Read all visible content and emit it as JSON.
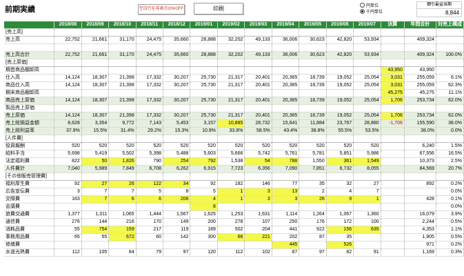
{
  "header": {
    "title": "前期実績",
    "toggle_label": "空白行を非表示ON/OFF",
    "print_label": "印刷",
    "unit_yen": "円単位",
    "unit_thousand": "千円単位",
    "days_label": "棚引最益当期",
    "days_value": "8,844"
  },
  "table": {
    "columns": [
      "2018/08",
      "2018/09",
      "2018/10",
      "2018/11",
      "2018/12",
      "2019/01",
      "2019/02",
      "2019/03",
      "2019/04",
      "2019/05",
      "2019/06",
      "2019/07",
      "決算",
      "年間合計",
      "対売上構成"
    ],
    "rows": [
      {
        "label": "[売上高]",
        "type": "section",
        "cells": [
          "",
          "",
          "",
          "",
          "",
          "",
          "",
          "",
          "",
          "",
          "",
          "",
          "",
          "",
          ""
        ]
      },
      {
        "label": "売上高",
        "cells": [
          "22,752",
          "21,661",
          "31,170",
          "24,475",
          "35,660",
          "28,888",
          "32,202",
          "49,133",
          "36,006",
          "30,623",
          "42,820",
          "53,934",
          "",
          "409,324",
          ""
        ]
      },
      {
        "label": "",
        "cells": [
          "",
          "",
          "",
          "",
          "",
          "",
          "",
          "",
          "",
          "",
          "",
          "",
          "",
          "",
          ""
        ]
      },
      {
        "label": "売上高合計",
        "type": "total",
        "cells": [
          "22,752",
          "21,661",
          "31,170",
          "24,475",
          "35,660",
          "28,888",
          "32,202",
          "49,133",
          "36,006",
          "30,623",
          "42,820",
          "53,934",
          "",
          "409,324",
          "100.0%"
        ]
      },
      {
        "label": "[売上原価]",
        "type": "section",
        "cells": [
          "",
          "",
          "",
          "",
          "",
          "",
          "",
          "",
          "",
          "",
          "",
          "",
          "",
          "",
          ""
        ]
      },
      {
        "label": "期首商品棚卸高",
        "cells": [
          "",
          "",
          "",
          "",
          "",
          "",
          "",
          "",
          "",
          "",
          "",
          "",
          "43,950",
          "43,950",
          ""
        ],
        "hl": [
          12
        ]
      },
      {
        "label": "仕入高",
        "cells": [
          "14,124",
          "18,307",
          "21,398",
          "17,332",
          "30,207",
          "25,730",
          "21,317",
          "20,401",
          "20,365",
          "18,739",
          "19,052",
          "25,054",
          "3,031",
          "255,059",
          "6.1%"
        ],
        "hl": [
          12
        ]
      },
      {
        "label": "商品仕入高",
        "cells": [
          "14,124",
          "18,307",
          "21,398",
          "17,332",
          "30,207",
          "25,730",
          "21,317",
          "20,401",
          "20,365",
          "18,739",
          "19,052",
          "25,054",
          "3,031",
          "255,059",
          "62.3%"
        ],
        "hl": [
          12
        ]
      },
      {
        "label": "期末商品棚卸高",
        "cells": [
          "",
          "",
          "",
          "",
          "",
          "",
          "",
          "",
          "",
          "",
          "",
          "",
          "45,275",
          "45,275",
          "11.1%"
        ],
        "hl": [
          12
        ]
      },
      {
        "label": "商品売上原価",
        "type": "total",
        "cells": [
          "14,124",
          "18,307",
          "21,398",
          "17,332",
          "30,207",
          "25,730",
          "21,317",
          "20,401",
          "20,365",
          "18,739",
          "19,052",
          "25,054",
          "1,706",
          "253,734",
          "62.0%"
        ],
        "hl": [
          12
        ]
      },
      {
        "label": "製品売上原価",
        "cells": [
          "",
          "",
          "",
          "",
          "",
          "",
          "",
          "",
          "",
          "",
          "",
          "",
          "",
          "",
          ""
        ]
      },
      {
        "label": "売上原価",
        "type": "total",
        "cells": [
          "14,124",
          "18,307",
          "21,398",
          "17,332",
          "30,207",
          "25,730",
          "21,317",
          "20,401",
          "20,365",
          "18,739",
          "19,052",
          "25,054",
          "1,706",
          "253,734",
          "62.0%"
        ],
        "hl": [
          12
        ]
      },
      {
        "label": "売上総損益金額",
        "type": "total",
        "cells": [
          "8,628",
          "3,354",
          "9,772",
          "7,143",
          "5,453",
          "3,157",
          "10,885",
          "28,732",
          "15,641",
          "11,884",
          "23,767",
          "28,880",
          "-1,706",
          "155,590",
          "38.0%"
        ],
        "hl": [
          6
        ],
        "neg": [
          12
        ]
      },
      {
        "label": "売上総利益率",
        "type": "total",
        "cells": [
          "37.9%",
          "15.5%",
          "31.4%",
          "29.2%",
          "15.3%",
          "10.9%",
          "33.8%",
          "58.5%",
          "43.4%",
          "38.8%",
          "55.5%",
          "53.5%",
          "",
          "38.0%",
          "0.0%"
        ]
      },
      {
        "label": "[人件費]",
        "type": "section",
        "cells": [
          "",
          "",
          "",
          "",
          "",
          "",
          "",
          "",
          "",
          "",
          "",
          "",
          "",
          "",
          ""
        ]
      },
      {
        "label": "役員報酬",
        "cells": [
          "520",
          "520",
          "520",
          "520",
          "520",
          "520",
          "520",
          "520",
          "520",
          "520",
          "520",
          "520",
          "",
          "6,240",
          "1.5%"
        ]
      },
      {
        "label": "給料手当",
        "cells": [
          "5,698",
          "5,419",
          "5,502",
          "5,398",
          "5,488",
          "5,603",
          "5,666",
          "5,742",
          "5,761",
          "5,781",
          "5,851",
          "5,986",
          "",
          "67,556",
          "16.5%"
        ]
      },
      {
        "label": "法定福利費",
        "cells": [
          "822",
          "50",
          "1,826",
          "790",
          "254",
          "792",
          "1,538",
          "54",
          "788",
          "1,550",
          "361",
          "1,549",
          "",
          "10,373",
          "2.5%"
        ],
        "hl": [
          1,
          2,
          4,
          5,
          7,
          8,
          10,
          11
        ]
      },
      {
        "label": "人件費計",
        "type": "total",
        "cells": [
          "7,040",
          "5,989",
          "7,849",
          "6,708",
          "6,262",
          "6,915",
          "7,723",
          "6,356",
          "7,090",
          "7,851",
          "6,732",
          "8,055",
          "",
          "84,569",
          "20.7%"
        ]
      },
      {
        "label": "[その他販売管理費]",
        "type": "section",
        "cells": [
          "",
          "",
          "",
          "",
          "",
          "",
          "",
          "",
          "",
          "",
          "",
          "",
          "",
          "",
          ""
        ]
      },
      {
        "label": "福利厚生費",
        "cells": [
          "92",
          "27",
          "26",
          "122",
          "34",
          "92",
          "182",
          "146",
          "77",
          "35",
          "32",
          "27",
          "",
          "892",
          "0.2%"
        ],
        "hl": [
          1,
          2,
          3,
          4
        ]
      },
      {
        "label": "広告宣伝費",
        "cells": [
          "3",
          "7",
          "7",
          "5",
          "8",
          "5",
          "1",
          "3",
          "13",
          "2",
          "4",
          "7",
          "",
          "",
          "0.0%"
        ],
        "hl": [
          6,
          7,
          8
        ]
      },
      {
        "label": "交際費",
        "cells": [
          "163",
          "7",
          "6",
          "6",
          "206",
          "4",
          "1",
          "3",
          "3",
          "26",
          "9",
          "1",
          "",
          "428",
          "0.1%"
        ],
        "hl": [
          1,
          2,
          3,
          4,
          5,
          6,
          7,
          8,
          9,
          10,
          11
        ]
      },
      {
        "label": "会議費",
        "cells": [
          "",
          "",
          "",
          "",
          "",
          "8",
          "",
          "",
          "",
          "",
          "",
          "",
          "",
          "",
          "0.0%"
        ],
        "hl": [
          5
        ]
      },
      {
        "label": "旅費交通費",
        "cells": [
          "1,377",
          "1,311",
          "1,065",
          "1,444",
          "1,567",
          "1,625",
          "1,253",
          "1,631",
          "1,114",
          "1,264",
          "1,067",
          "1,360",
          "",
          "16,079",
          "3.9%"
        ]
      },
      {
        "label": "通信費",
        "cells": [
          "276",
          "144",
          "216",
          "170",
          "149",
          "200",
          "278",
          "107",
          "250",
          "176",
          "172",
          "100",
          "",
          "2,244",
          "0.5%"
        ]
      },
      {
        "label": "消耗品費",
        "cells": [
          "55",
          "754",
          "159",
          "217",
          "119",
          "189",
          "502",
          "204",
          "441",
          "922",
          "156",
          "635",
          "",
          "4,353",
          "1.1%"
        ],
        "hl": [
          1,
          2,
          10,
          11
        ]
      },
      {
        "label": "事務用品費",
        "cells": [
          "65",
          "55",
          "672",
          "60",
          "142",
          "300",
          "66",
          "221",
          "202",
          "87",
          "35",
          "",
          "",
          "1,905",
          "0.5%"
        ],
        "hl": [
          2,
          6,
          7
        ]
      },
      {
        "label": "修繕費",
        "cells": [
          "",
          "",
          "",
          "",
          "",
          "",
          "",
          "",
          "445",
          "",
          "526",
          "",
          "",
          "971",
          "0.2%"
        ],
        "hl": [
          8,
          10
        ]
      },
      {
        "label": "水道光熱費",
        "cells": [
          "112",
          "105",
          "84",
          "79",
          "97",
          "120",
          "112",
          "102",
          "87",
          "97",
          "82",
          "91",
          "",
          "1,169",
          "0.3%"
        ]
      }
    ]
  }
}
